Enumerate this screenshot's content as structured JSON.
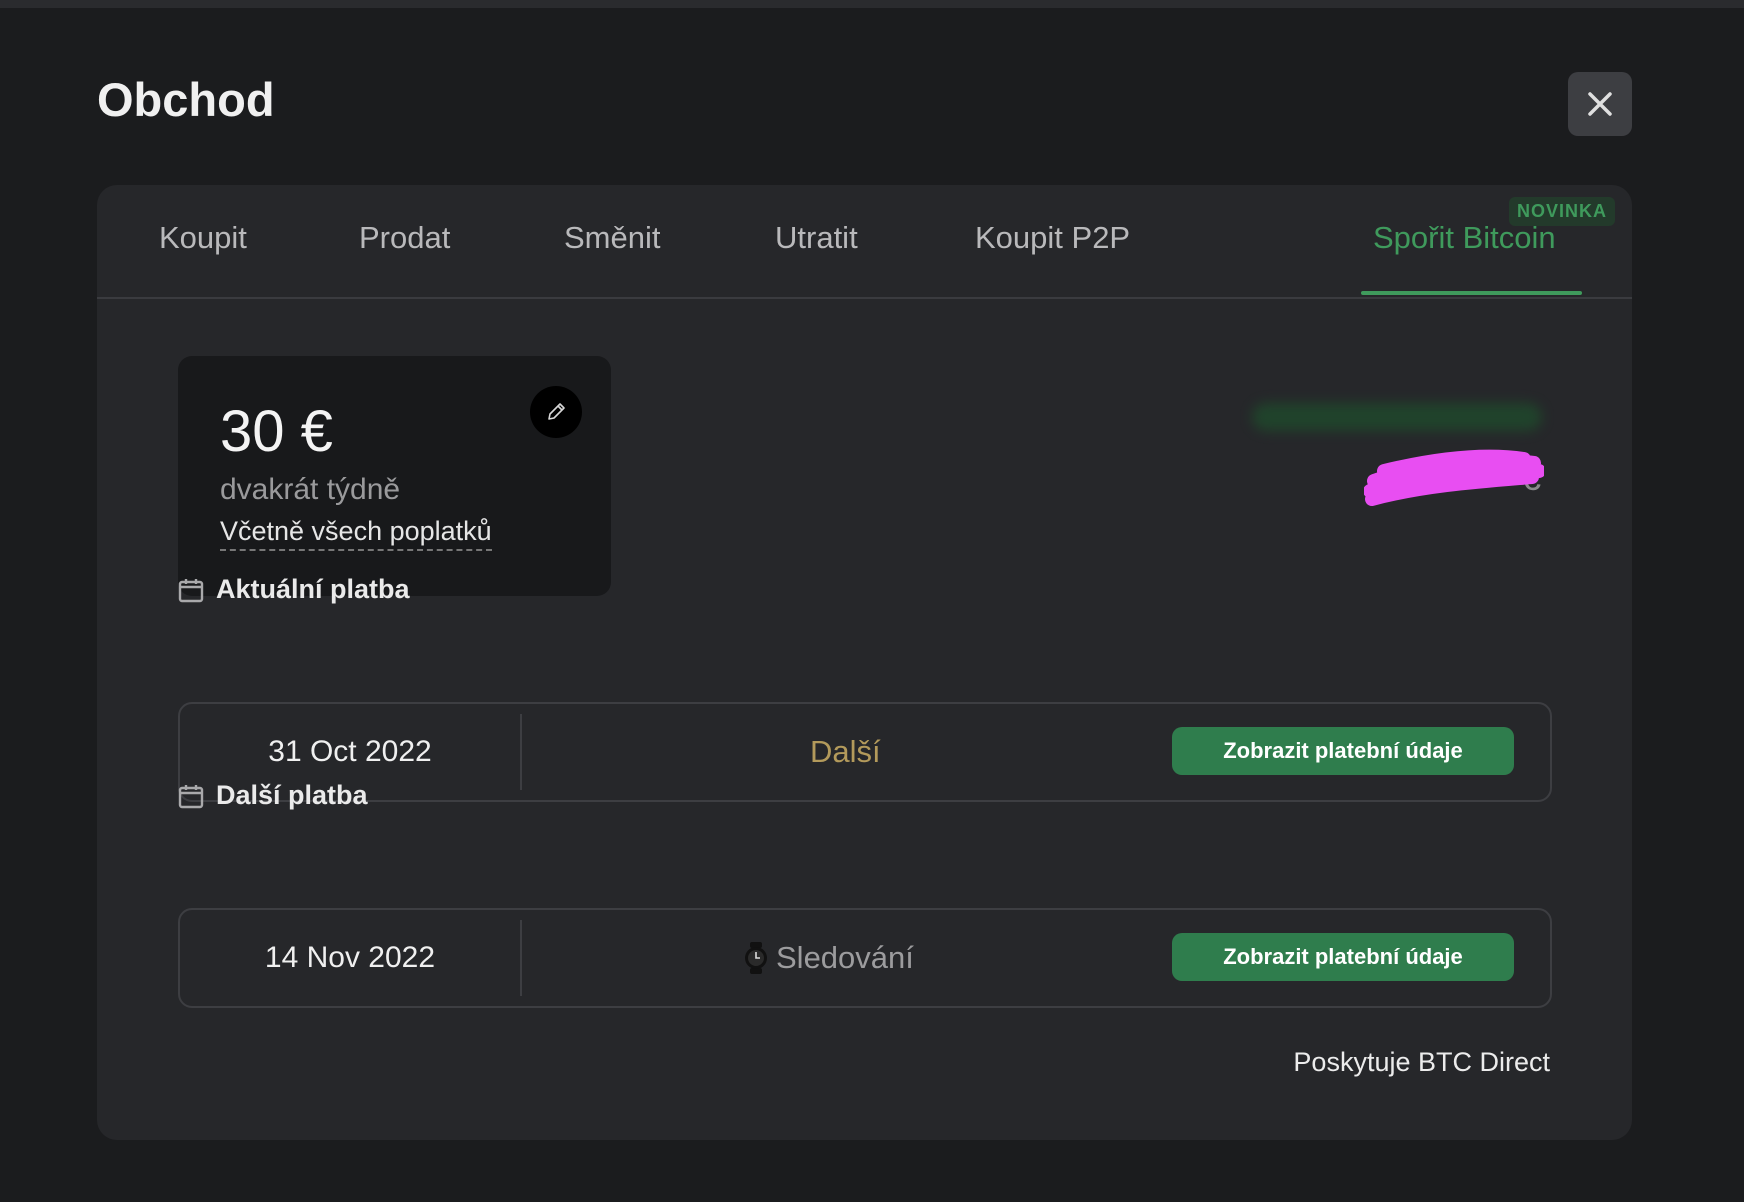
{
  "dialog": {
    "title": "Obchod"
  },
  "tabs": [
    {
      "label": "Koupit"
    },
    {
      "label": "Prodat"
    },
    {
      "label": "Směnit"
    },
    {
      "label": "Utratit"
    },
    {
      "label": "Koupit P2P"
    },
    {
      "label": "Spořit Bitcoin",
      "badge": "NOVINKA",
      "active": true
    }
  ],
  "savings": {
    "amount": "30 €",
    "frequency": "dvakrát týdně",
    "fees_link": "Včetně všech poplatků",
    "value_suffix": "€"
  },
  "current_payment": {
    "title": "Aktuální platba",
    "date": "31 Oct 2022",
    "status": "Další",
    "button": "Zobrazit platební údaje"
  },
  "next_payment": {
    "title": "Další platba",
    "date": "14 Nov 2022",
    "status": "Sledování",
    "button": "Zobrazit platební údaje"
  },
  "footer": {
    "provider": "Poskytuje BTC Direct"
  },
  "colors": {
    "accent": "#3f9a5c",
    "background": "#1b1c1e",
    "panel": "#26272a",
    "next_status": "#b39a5b"
  }
}
